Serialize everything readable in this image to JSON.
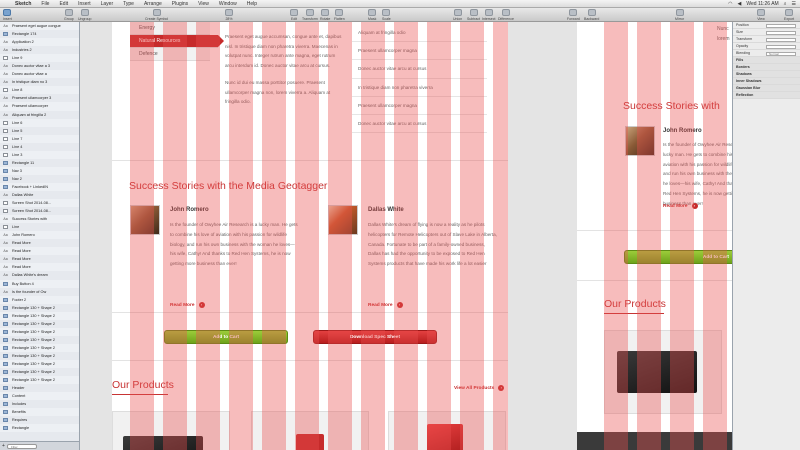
{
  "menubar": {
    "app": "Sketch",
    "items": [
      "File",
      "Edit",
      "Insert",
      "Layer",
      "Type",
      "Arrange",
      "Plugins",
      "View",
      "Window",
      "Help"
    ],
    "clock": "Wed 11:26 AM"
  },
  "toolbar": {
    "insert": "Insert",
    "group": "Group",
    "ungroup": "Ungroup",
    "create_symbol": "Create Symbol",
    "zoom": "28%",
    "edit": "Edit",
    "transform": "Transform",
    "rotate": "Rotate",
    "flatten": "Flatten",
    "mask": "Mask",
    "scale": "Scale",
    "union": "Union",
    "subtract": "Subtract",
    "intersect": "Intersect",
    "difference": "Difference",
    "forward": "Forward",
    "backward": "Backward",
    "mirror": "Mirror",
    "view": "View",
    "export": "Export"
  },
  "layers": [
    "Praesent eget augue congue",
    "Rectangle 174",
    "Application 2",
    "Industries 2",
    "Line 9",
    "Donec auctor vitae a 3",
    "Donec auctor vitae a",
    "In tristique diam no 3",
    "Line 8",
    "Praesent ullamcorper 3",
    "Praesent ullamcorper",
    "Aliquam at fringilla 2",
    "Line 6",
    "Line 5",
    "Line 7",
    "Line 4",
    "Line 3",
    "Rectangle 11",
    "Nav 3",
    "Nav 2",
    "Facebook + LinkedIN",
    "Dallas White",
    "Screen Shot 2014-08...",
    "Screen Shot 2014-08...",
    "Success Stories with",
    "Line",
    "John Romero",
    "Read More",
    "Read More",
    "Read More",
    "Read More",
    "Dallas White's dream",
    "Buy Button 4",
    "Is the founder of Ow",
    "Footer 2",
    "Rectangle 130 + Shape 2",
    "Rectangle 130 + Shape 2",
    "Rectangle 130 + Shape 2",
    "Rectangle 130 + Shape 2",
    "Rectangle 130 + Shape 2",
    "Rectangle 130 + Shape 2",
    "Rectangle 130 + Shape 2",
    "Rectangle 130 + Shape 2",
    "Rectangle 130 + Shape 2",
    "Rectangle 130 + Shape 2",
    "Header",
    "Content",
    "Includes",
    "Benefits",
    "Requires",
    "Rectangle"
  ],
  "layer_filter": "Filter",
  "page": {
    "nav": [
      "Energy",
      "Natural Resources",
      "Defence"
    ],
    "desc_paragraphs": [
      "Praesent eget augue accumsan, congue ante et, dapibus nisl. In tristique diam non pharetra viverra. Maecenas in volutpat nunc. Integer rutrum ante magna, eget rutrum arcu interdum id. Donec auctor vitae arcu at cursus.",
      "Nunc id dui eu massa porttitor posuere. Praesent ullamcorper magna non, lorem viverra a. Aliquam at fringilla odio."
    ],
    "bullets": [
      "Aliquam at fringilla odio",
      "Praesent ullamcorper magna",
      "Donec auctor vitae arcu at cursus",
      "In tristique diam non pharetra viverra",
      "Praesent ullamcorper magna",
      "Donec auctor vitae arcu at cursus"
    ],
    "success_title": "Success Stories with the Media Geotagger",
    "testimonials": [
      {
        "name": "John Romero",
        "body": "Is the founder of Owyhee Air Research is a lucky man. He gets to combine his love of aviation with his passion for wildlife biology, and run his own business with the woman he loves—his wife, Cathy! And thanks to Red Hen Systems, he is now getting more business than ever!",
        "read_more": "Read More"
      },
      {
        "name": "Dallas White",
        "body": "Dallas White's dream of flying is now a reality as he pilots helicopters for Remote Helicopters out of Slave Lake in Alberta, Canada. Fortunate to be part of a family-owned business, Dallas has had the opportunity to be exposed to Red Hen Systems products that have made his work life a lot easier",
        "read_more": "Read More"
      }
    ],
    "add_to_cart": "Add to Cart",
    "download_spec": "Download Spec Sheet",
    "products_title": "Our Products",
    "view_all": "View All Products"
  },
  "mobile": {
    "top_text": [
      "Nunc",
      "lorem"
    ],
    "success_title": "Success Stories with",
    "name": "John Romero",
    "body": "Is the founder of Owyhee Air Research is a lucky man. He gets to combine his love of aviation with his passion for wildlife biology, and run his own business with the woman he loves—his wife, Cathy! And thanks to Red Hen Systems, he is now getting more business than ever!",
    "read_more": "Read More",
    "add_to_cart": "Add to Cart",
    "products_title": "Our Products"
  },
  "inspector": {
    "rows": [
      "Position",
      "Size",
      "Transform",
      "Opacity",
      "Blending",
      "Fills",
      "Borders",
      "Shadows",
      "Inner Shadows",
      "Gaussian Blur",
      "Reflection"
    ],
    "blending_value": "Normal"
  },
  "colors": {
    "accent_red": "#c62b2b",
    "grid_overlay": "rgba(235,80,80,0.38)",
    "green_button": "#7fb626"
  }
}
